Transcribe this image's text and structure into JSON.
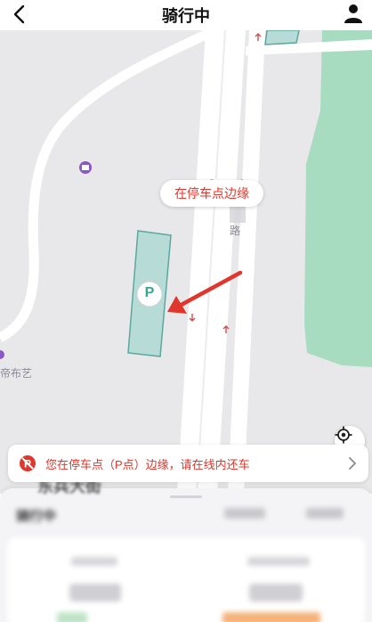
{
  "header": {
    "title": "骑行中",
    "back_icon": "chevron-left-icon",
    "profile_icon": "user-icon"
  },
  "map": {
    "bubble_text": "在停车点边缘",
    "parking_marker": "P",
    "road_label": "路",
    "poi_label": "帝布艺",
    "locate_icon": "locate-icon",
    "colors": {
      "land": "#e8e8ea",
      "road": "#ffffff",
      "park": "#a8dcc0",
      "parking_zone": "#b7dcd8",
      "accent": "#e0362c",
      "user_dot": "#2f6bea"
    }
  },
  "notice": {
    "text": "您在停车点（P点）边缘，请在线内还车",
    "icon": "no-parking-icon",
    "chevron_icon": "chevron-right-icon"
  },
  "sheet": {
    "street_label": "东兵大街",
    "title": "骑行中"
  }
}
